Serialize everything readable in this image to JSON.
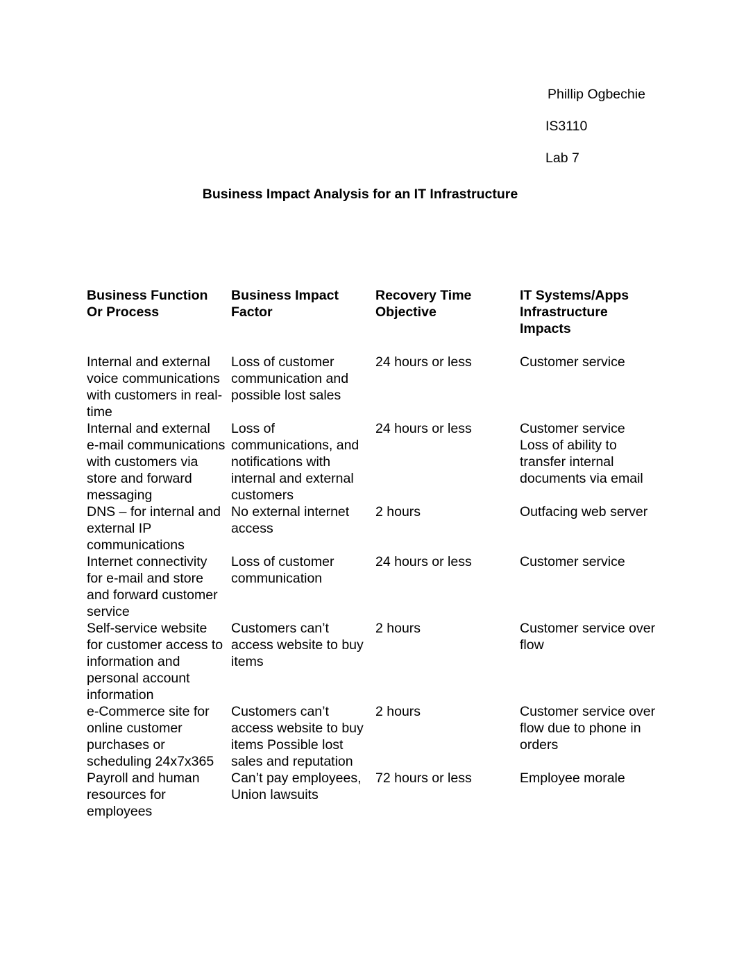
{
  "document": {
    "header_lines": [
      "Phillip Ogbechie",
      "IS3110",
      "Lab 7"
    ],
    "title": "Business Impact Analysis for an IT Infrastructure"
  },
  "table": {
    "columns": [
      "Business Function Or Process",
      "Business Impact Factor",
      "Recovery Time Objective",
      "IT Systems/Apps Infrastructure Impacts"
    ],
    "rows": [
      {
        "function": "Internal and external voice communications with customers in real-time",
        "impact": "Loss of customer communication and possible lost sales",
        "rto": "24 hours or less",
        "systems": "Customer service"
      },
      {
        "function": "Internal and external e-mail communications with customers via store and forward messaging",
        "impact": "Loss of communications, and notifications with internal and external customers",
        "rto": "24 hours or less",
        "systems": "Customer service Loss of ability to transfer internal documents via email"
      },
      {
        "function": "DNS – for internal and external IP communications",
        "impact": "No external internet access",
        "rto": "2 hours",
        "systems": "Outfacing web server"
      },
      {
        "function": "Internet connectivity for e-mail and store and forward customer service",
        "impact": "Loss of customer communication",
        "rto": "24 hours or less",
        "systems": "Customer service"
      },
      {
        "function": "Self-service website for customer access to information and personal account information",
        "impact": "Customers can’t access website to buy items",
        "rto": "2 hours",
        "systems": "Customer service over flow"
      },
      {
        "function": "e-Commerce site for online customer purchases or scheduling 24x7x365",
        "impact": "Customers can’t access website to buy items Possible lost sales and reputation",
        "rto": "2 hours",
        "systems": "Customer service over flow due to phone in orders"
      },
      {
        "function": "Payroll and human resources for employees",
        "impact": "Can’t pay employees, Union lawsuits",
        "rto": "72 hours or less",
        "systems": "Employee morale"
      }
    ]
  }
}
